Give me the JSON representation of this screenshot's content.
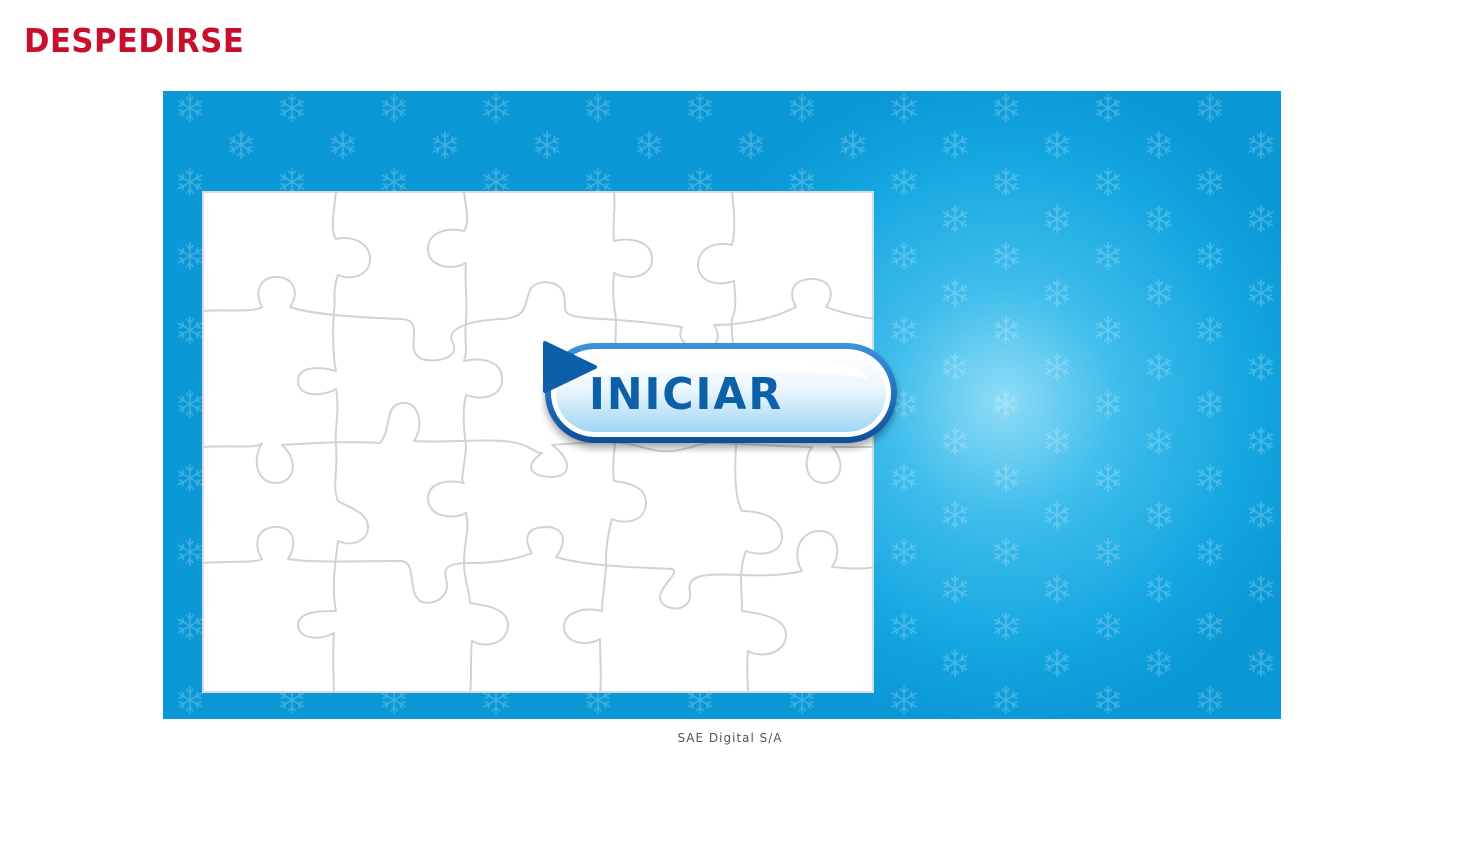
{
  "header": {
    "title": "DESPEDIRSE"
  },
  "game": {
    "start_label": "INICIAR",
    "start_icon": "play-triangle-icon",
    "background_icon": "snowflake-icon",
    "puzzle_grid": {
      "columns": 5,
      "rows": 4
    }
  },
  "footer": {
    "credit": "SAE Digital S/A"
  },
  "colors": {
    "title": "#c8102e",
    "stage_blue": "#0fa4de",
    "stage_glow": "#8fdcf6",
    "button_text": "#0d5faa",
    "button_rim": "#1d73c2",
    "puzzle_line": "#cfd3d6"
  }
}
